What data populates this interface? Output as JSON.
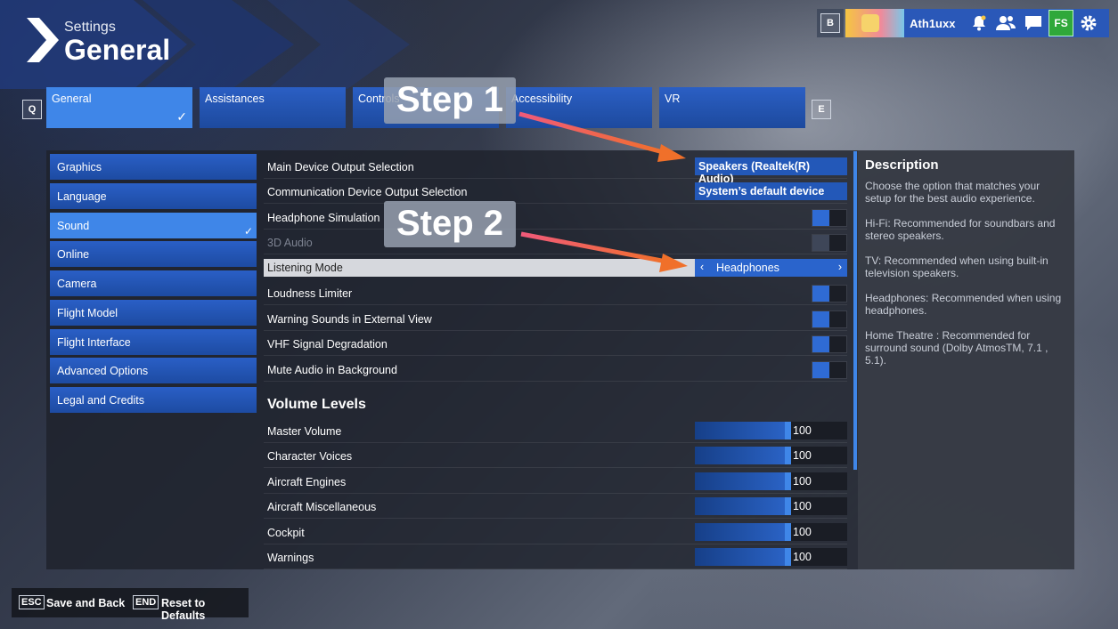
{
  "header": {
    "settings_label": "Settings",
    "title": "General"
  },
  "topbar": {
    "b_key": "B",
    "username": "Ath1uxx",
    "store_label": "FS"
  },
  "tabs": {
    "left_key": "Q",
    "right_key": "E",
    "items": [
      {
        "label": "General"
      },
      {
        "label": "Assistances"
      },
      {
        "label": "Controls"
      },
      {
        "label": "Accessibility"
      },
      {
        "label": "VR"
      }
    ]
  },
  "nav": {
    "items": [
      {
        "label": "Graphics"
      },
      {
        "label": "Language"
      },
      {
        "label": "Sound"
      },
      {
        "label": "Online"
      },
      {
        "label": "Camera"
      },
      {
        "label": "Flight Model"
      },
      {
        "label": "Flight Interface"
      },
      {
        "label": "Advanced Options"
      },
      {
        "label": "Legal and Credits"
      }
    ]
  },
  "settings": {
    "main_device": {
      "label": "Main Device Output Selection",
      "value": "Speakers (Realtek(R) Audio)"
    },
    "comm_device": {
      "label": "Communication Device Output Selection",
      "value": "System’s default device"
    },
    "headphone_sim": {
      "label": "Headphone Simulation"
    },
    "audio3d": {
      "label": "3D Audio"
    },
    "listening_mode": {
      "label": "Listening Mode",
      "value": "Headphones"
    },
    "loudness": {
      "label": "Loudness Limiter"
    },
    "warning_sounds": {
      "label": "Warning Sounds in External View"
    },
    "vhf": {
      "label": "VHF Signal Degradation"
    },
    "mute_bg": {
      "label": "Mute Audio in Background"
    }
  },
  "volume": {
    "title": "Volume Levels",
    "items": [
      {
        "label": "Master Volume",
        "value": "100"
      },
      {
        "label": "Character Voices",
        "value": "100"
      },
      {
        "label": "Aircraft Engines",
        "value": "100"
      },
      {
        "label": "Aircraft Miscellaneous",
        "value": "100"
      },
      {
        "label": "Cockpit",
        "value": "100"
      },
      {
        "label": "Warnings",
        "value": "100"
      }
    ]
  },
  "description": {
    "title": "Description",
    "paragraphs": [
      "Choose the option that matches your setup for the best audio experience.",
      "Hi-Fi: Recommended for soundbars and stereo speakers.",
      "TV: Recommended when using built-in television speakers.",
      "Headphones: Recommended when using headphones.",
      "Home Theatre : Recommended for surround sound (Dolby AtmosTM, 7.1 , 5.1)."
    ]
  },
  "footer": {
    "save_key": "ESC",
    "save_label": "Save and Back",
    "reset_key": "END",
    "reset_label": "Reset to Defaults"
  },
  "annotations": {
    "step1": "Step 1",
    "step2": "Step 2"
  },
  "colors": {
    "accent": "#3f86e8",
    "tab_blue": "#2358b8",
    "arrow": "#e8405a"
  }
}
